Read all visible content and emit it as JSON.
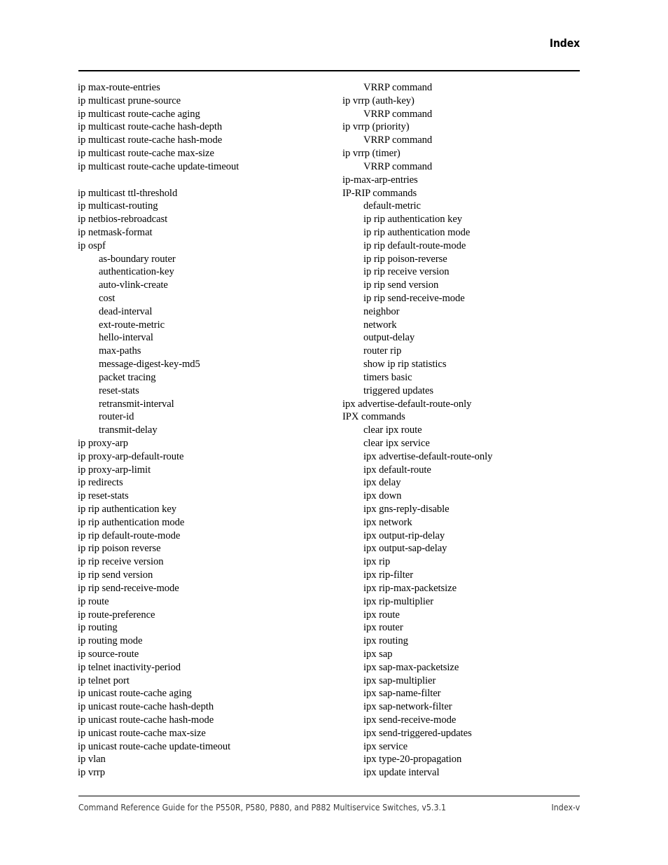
{
  "header": {
    "title": "Index"
  },
  "footer": {
    "guide_text": "Command Reference Guide for the P550R, P580, P880, and P882 Multiservice Switches, v5.3.1",
    "page_number": "Index-v"
  },
  "colors": {
    "text": "#000000",
    "footer_text": "#3a3a3a",
    "rule": "#000000",
    "background": "#ffffff"
  },
  "columns": [
    {
      "name": "left-column",
      "entries": [
        {
          "text": "ip max-route-entries",
          "level": 1
        },
        {
          "text": "ip multicast prune-source",
          "level": 1
        },
        {
          "text": "ip multicast route-cache aging",
          "level": 1
        },
        {
          "text": "ip multicast route-cache hash-depth",
          "level": 1
        },
        {
          "text": "ip multicast route-cache hash-mode",
          "level": 1
        },
        {
          "text": "ip multicast route-cache max-size",
          "level": 1
        },
        {
          "text": "ip multicast route-cache update-timeout",
          "level": 1
        },
        {
          "text": "",
          "level": 0
        },
        {
          "text": "ip multicast ttl-threshold",
          "level": 1
        },
        {
          "text": "ip multicast-routing",
          "level": 1
        },
        {
          "text": "ip netbios-rebroadcast",
          "level": 1
        },
        {
          "text": "ip netmask-format",
          "level": 1
        },
        {
          "text": "ip ospf",
          "level": 1
        },
        {
          "text": "as-boundary router",
          "level": 2
        },
        {
          "text": "authentication-key",
          "level": 2
        },
        {
          "text": "auto-vlink-create",
          "level": 2
        },
        {
          "text": "cost",
          "level": 2
        },
        {
          "text": "dead-interval",
          "level": 2
        },
        {
          "text": "ext-route-metric",
          "level": 2
        },
        {
          "text": "hello-interval",
          "level": 2
        },
        {
          "text": "max-paths",
          "level": 2
        },
        {
          "text": "message-digest-key-md5",
          "level": 2
        },
        {
          "text": "packet tracing",
          "level": 2
        },
        {
          "text": "reset-stats",
          "level": 2
        },
        {
          "text": "retransmit-interval",
          "level": 2
        },
        {
          "text": "router-id",
          "level": 2
        },
        {
          "text": "transmit-delay",
          "level": 2
        },
        {
          "text": "ip proxy-arp",
          "level": 1
        },
        {
          "text": "ip proxy-arp-default-route",
          "level": 1
        },
        {
          "text": "ip proxy-arp-limit",
          "level": 1
        },
        {
          "text": "ip redirects",
          "level": 1
        },
        {
          "text": "ip reset-stats",
          "level": 1
        },
        {
          "text": "ip rip authentication key",
          "level": 1
        },
        {
          "text": "ip rip authentication mode",
          "level": 1
        },
        {
          "text": "ip rip default-route-mode",
          "level": 1
        },
        {
          "text": "ip rip poison reverse",
          "level": 1
        },
        {
          "text": "ip rip receive version",
          "level": 1
        },
        {
          "text": "ip rip send version",
          "level": 1
        },
        {
          "text": "ip rip send-receive-mode",
          "level": 1
        },
        {
          "text": "ip route",
          "level": 1
        },
        {
          "text": "ip route-preference",
          "level": 1
        },
        {
          "text": "ip routing",
          "level": 1
        },
        {
          "text": "ip routing mode",
          "level": 1
        },
        {
          "text": "ip source-route",
          "level": 1
        },
        {
          "text": "ip telnet inactivity-period",
          "level": 1
        },
        {
          "text": "ip telnet port",
          "level": 1
        },
        {
          "text": "ip unicast route-cache aging",
          "level": 1
        },
        {
          "text": "ip unicast route-cache hash-depth",
          "level": 1
        },
        {
          "text": "ip unicast route-cache hash-mode",
          "level": 1
        },
        {
          "text": "ip unicast route-cache max-size",
          "level": 1
        },
        {
          "text": "ip unicast route-cache update-timeout",
          "level": 1
        },
        {
          "text": "ip vlan",
          "level": 1
        },
        {
          "text": "ip vrrp",
          "level": 1
        }
      ]
    },
    {
      "name": "right-column",
      "entries": [
        {
          "text": "VRRP command",
          "level": 2
        },
        {
          "text": "ip vrrp (auth-key)",
          "level": 1
        },
        {
          "text": "VRRP command",
          "level": 2
        },
        {
          "text": "ip vrrp (priority)",
          "level": 1
        },
        {
          "text": "VRRP command",
          "level": 2
        },
        {
          "text": "ip vrrp (timer)",
          "level": 1
        },
        {
          "text": "VRRP command",
          "level": 2
        },
        {
          "text": "ip-max-arp-entries",
          "level": 1
        },
        {
          "text": "IP-RIP commands",
          "level": 1
        },
        {
          "text": "default-metric",
          "level": 2
        },
        {
          "text": "ip rip authentication key",
          "level": 2
        },
        {
          "text": "ip rip authentication mode",
          "level": 2
        },
        {
          "text": "ip rip default-route-mode",
          "level": 2
        },
        {
          "text": "ip rip poison-reverse",
          "level": 2
        },
        {
          "text": "ip rip receive version",
          "level": 2
        },
        {
          "text": "ip rip send version",
          "level": 2
        },
        {
          "text": "ip rip send-receive-mode",
          "level": 2
        },
        {
          "text": "neighbor",
          "level": 2
        },
        {
          "text": "network",
          "level": 2
        },
        {
          "text": "output-delay",
          "level": 2
        },
        {
          "text": "router rip",
          "level": 2
        },
        {
          "text": "show ip rip statistics",
          "level": 2
        },
        {
          "text": "timers basic",
          "level": 2
        },
        {
          "text": "triggered updates",
          "level": 2
        },
        {
          "text": "ipx advertise-default-route-only",
          "level": 1
        },
        {
          "text": "IPX commands",
          "level": 1
        },
        {
          "text": "clear ipx route",
          "level": 2
        },
        {
          "text": "clear ipx service",
          "level": 2
        },
        {
          "text": "ipx advertise-default-route-only",
          "level": 2
        },
        {
          "text": "ipx default-route",
          "level": 2
        },
        {
          "text": "ipx delay",
          "level": 2
        },
        {
          "text": "ipx down",
          "level": 2
        },
        {
          "text": "ipx gns-reply-disable",
          "level": 2
        },
        {
          "text": "ipx network",
          "level": 2
        },
        {
          "text": "ipx output-rip-delay",
          "level": 2
        },
        {
          "text": "ipx output-sap-delay",
          "level": 2
        },
        {
          "text": "ipx rip",
          "level": 2
        },
        {
          "text": "ipx rip-filter",
          "level": 2
        },
        {
          "text": "ipx rip-max-packetsize",
          "level": 2
        },
        {
          "text": "ipx rip-multiplier",
          "level": 2
        },
        {
          "text": "ipx route",
          "level": 2
        },
        {
          "text": "ipx router",
          "level": 2
        },
        {
          "text": "ipx routing",
          "level": 2
        },
        {
          "text": "ipx sap",
          "level": 2
        },
        {
          "text": "ipx sap-max-packetsize",
          "level": 2
        },
        {
          "text": "ipx sap-multiplier",
          "level": 2
        },
        {
          "text": "ipx sap-name-filter",
          "level": 2
        },
        {
          "text": "ipx sap-network-filter",
          "level": 2
        },
        {
          "text": "ipx send-receive-mode",
          "level": 2
        },
        {
          "text": "ipx send-triggered-updates",
          "level": 2
        },
        {
          "text": "ipx service",
          "level": 2
        },
        {
          "text": "ipx type-20-propagation",
          "level": 2
        },
        {
          "text": "ipx update interval",
          "level": 2
        }
      ]
    }
  ]
}
